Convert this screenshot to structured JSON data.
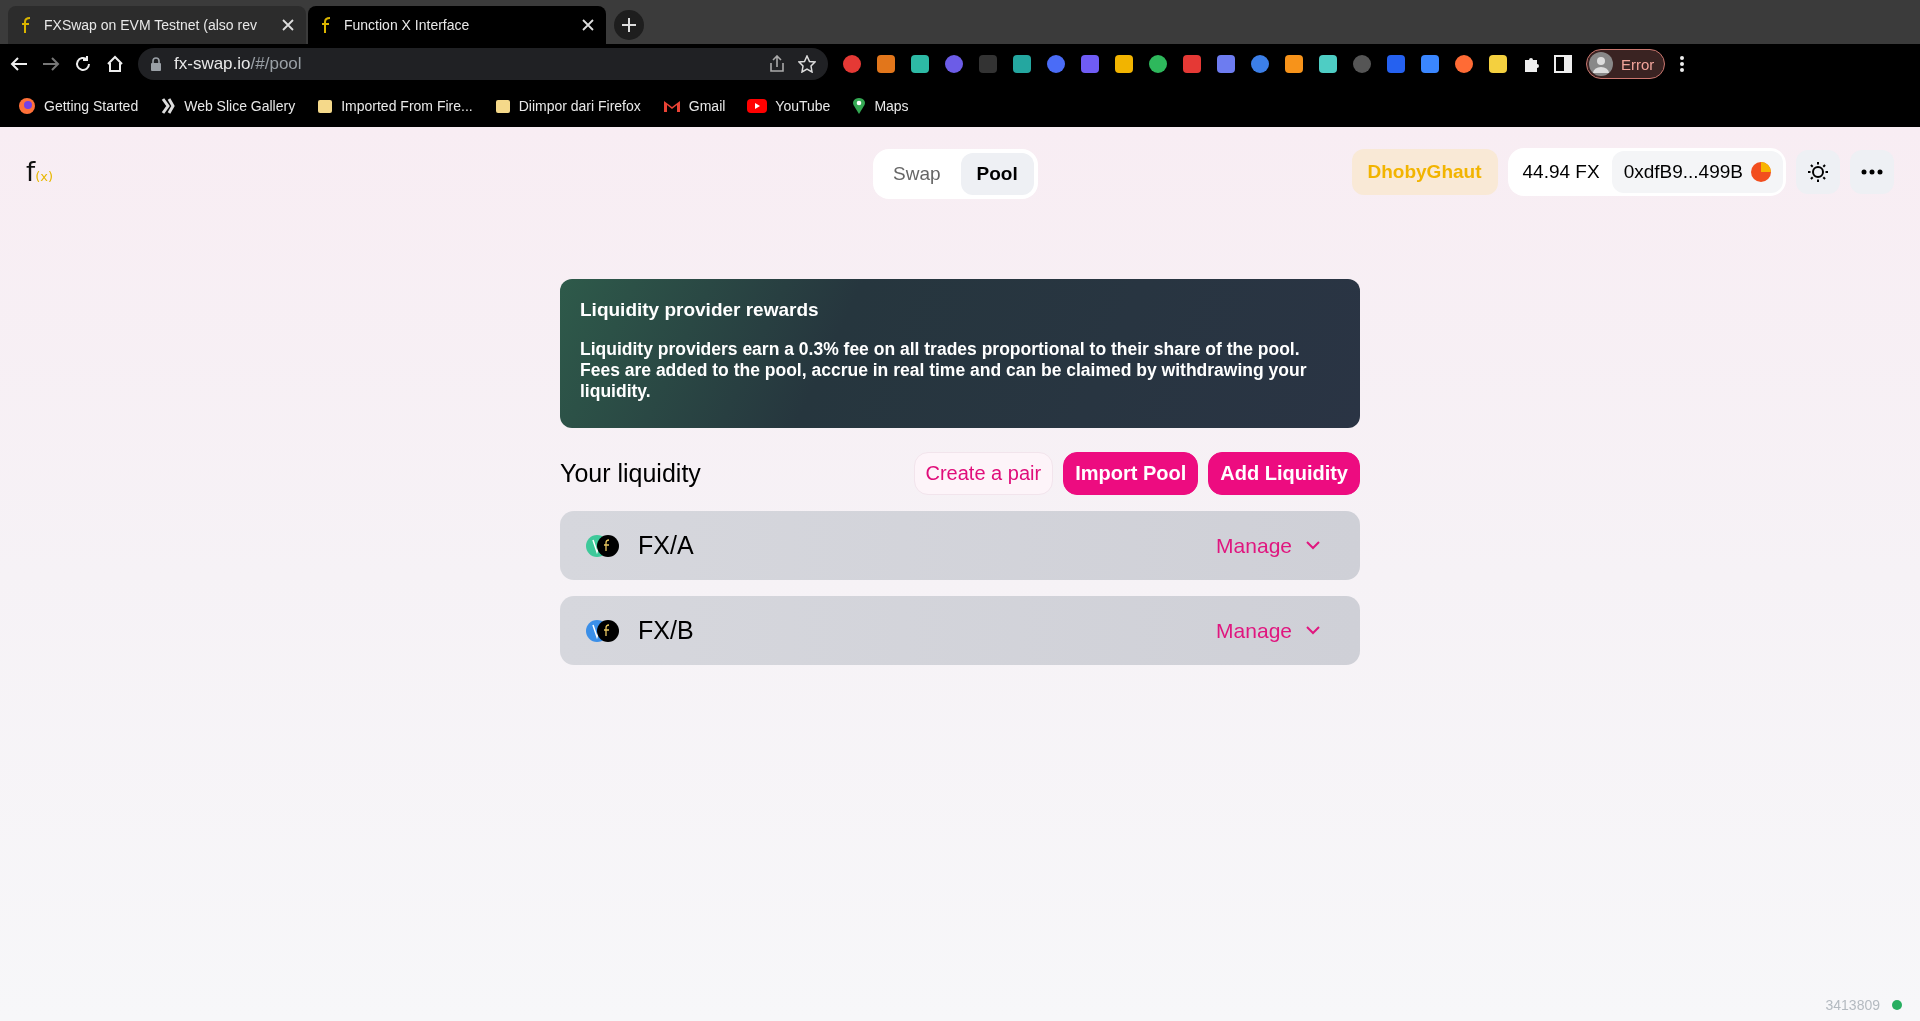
{
  "browser": {
    "tabs": [
      {
        "title": "FXSwap on EVM Testnet (also rev",
        "selected": false
      },
      {
        "title": "Function X Interface",
        "selected": true
      }
    ],
    "url_host": "fx-swap.io",
    "url_path": "/#/pool",
    "profile_label": "Error",
    "bookmarks": [
      {
        "label": "Getting Started",
        "kind": "firefox"
      },
      {
        "label": "Web Slice Gallery",
        "kind": "slice"
      },
      {
        "label": "Imported From Fire...",
        "kind": "folder"
      },
      {
        "label": "Diimpor dari Firefox",
        "kind": "folder"
      },
      {
        "label": "Gmail",
        "kind": "gmail"
      },
      {
        "label": "YouTube",
        "kind": "youtube"
      },
      {
        "label": "Maps",
        "kind": "maps"
      }
    ]
  },
  "header": {
    "logo": "f",
    "logo_sub": "(x)",
    "nav": [
      {
        "label": "Swap",
        "selected": false
      },
      {
        "label": "Pool",
        "selected": true
      }
    ],
    "network": "DhobyGhaut",
    "balance": "44.94 FX",
    "account": "0xdfB9...499B"
  },
  "banner": {
    "title": "Liquidity provider rewards",
    "body": "Liquidity providers earn a 0.3% fee on all trades proportional to their share of the pool. Fees are added to the pool, accrue in real time and can be claimed by withdrawing your liquidity."
  },
  "liquidity": {
    "heading": "Your liquidity",
    "actions": [
      {
        "label": "Create a pair",
        "kind": "outline"
      },
      {
        "label": "Import Pool",
        "kind": "filled"
      },
      {
        "label": "Add Liquidity",
        "kind": "filled"
      }
    ],
    "pairs": [
      {
        "color": "#3ec99a",
        "name": "FX/A",
        "action": "Manage"
      },
      {
        "color": "#3b8fe8",
        "name": "FX/B",
        "action": "Manage"
      }
    ]
  },
  "footer": {
    "block": "3413809"
  }
}
